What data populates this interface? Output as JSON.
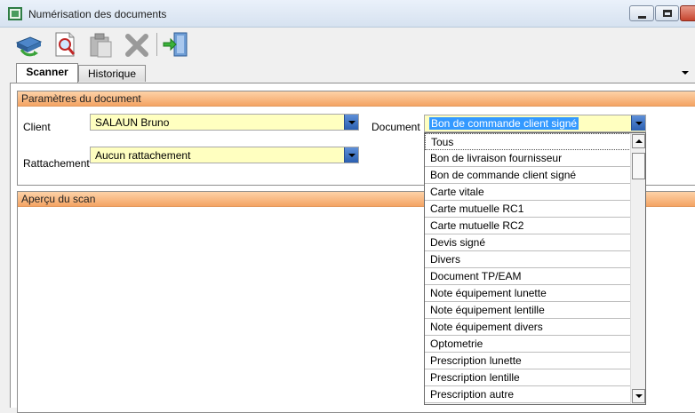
{
  "window": {
    "title": "Numérisation des documents"
  },
  "toolbar": {
    "buttons": [
      {
        "name": "scan-icon"
      },
      {
        "name": "preview-icon"
      },
      {
        "name": "paste-icon"
      },
      {
        "name": "delete-icon"
      },
      {
        "name": "exit-icon"
      }
    ]
  },
  "tabs": [
    {
      "label": "Scanner",
      "active": true
    },
    {
      "label": "Historique",
      "active": false
    }
  ],
  "params": {
    "header": "Paramètres du document",
    "client_label": "Client",
    "client_value": "SALAUN Bruno",
    "rattachement_label": "Rattachement",
    "rattachement_value": "Aucun rattachement",
    "document_label": "Document",
    "document_value": "Bon de commande client signé"
  },
  "preview": {
    "header": "Aperçu du scan"
  },
  "document_options": [
    "Tous",
    "Bon de livraison fournisseur",
    "Bon de commande client signé",
    "Carte vitale",
    "Carte mutuelle RC1",
    "Carte mutuelle RC2",
    "Devis signé",
    "Divers",
    "Document TP/EAM",
    "Note équipement lunette",
    "Note équipement lentille",
    "Note équipement divers",
    "Optometrie",
    "Prescription lunette",
    "Prescription lentille",
    "Prescription autre"
  ],
  "colors": {
    "group_header": "#f4a464",
    "combo_bg": "#ffffc0",
    "selection": "#3399ff"
  }
}
